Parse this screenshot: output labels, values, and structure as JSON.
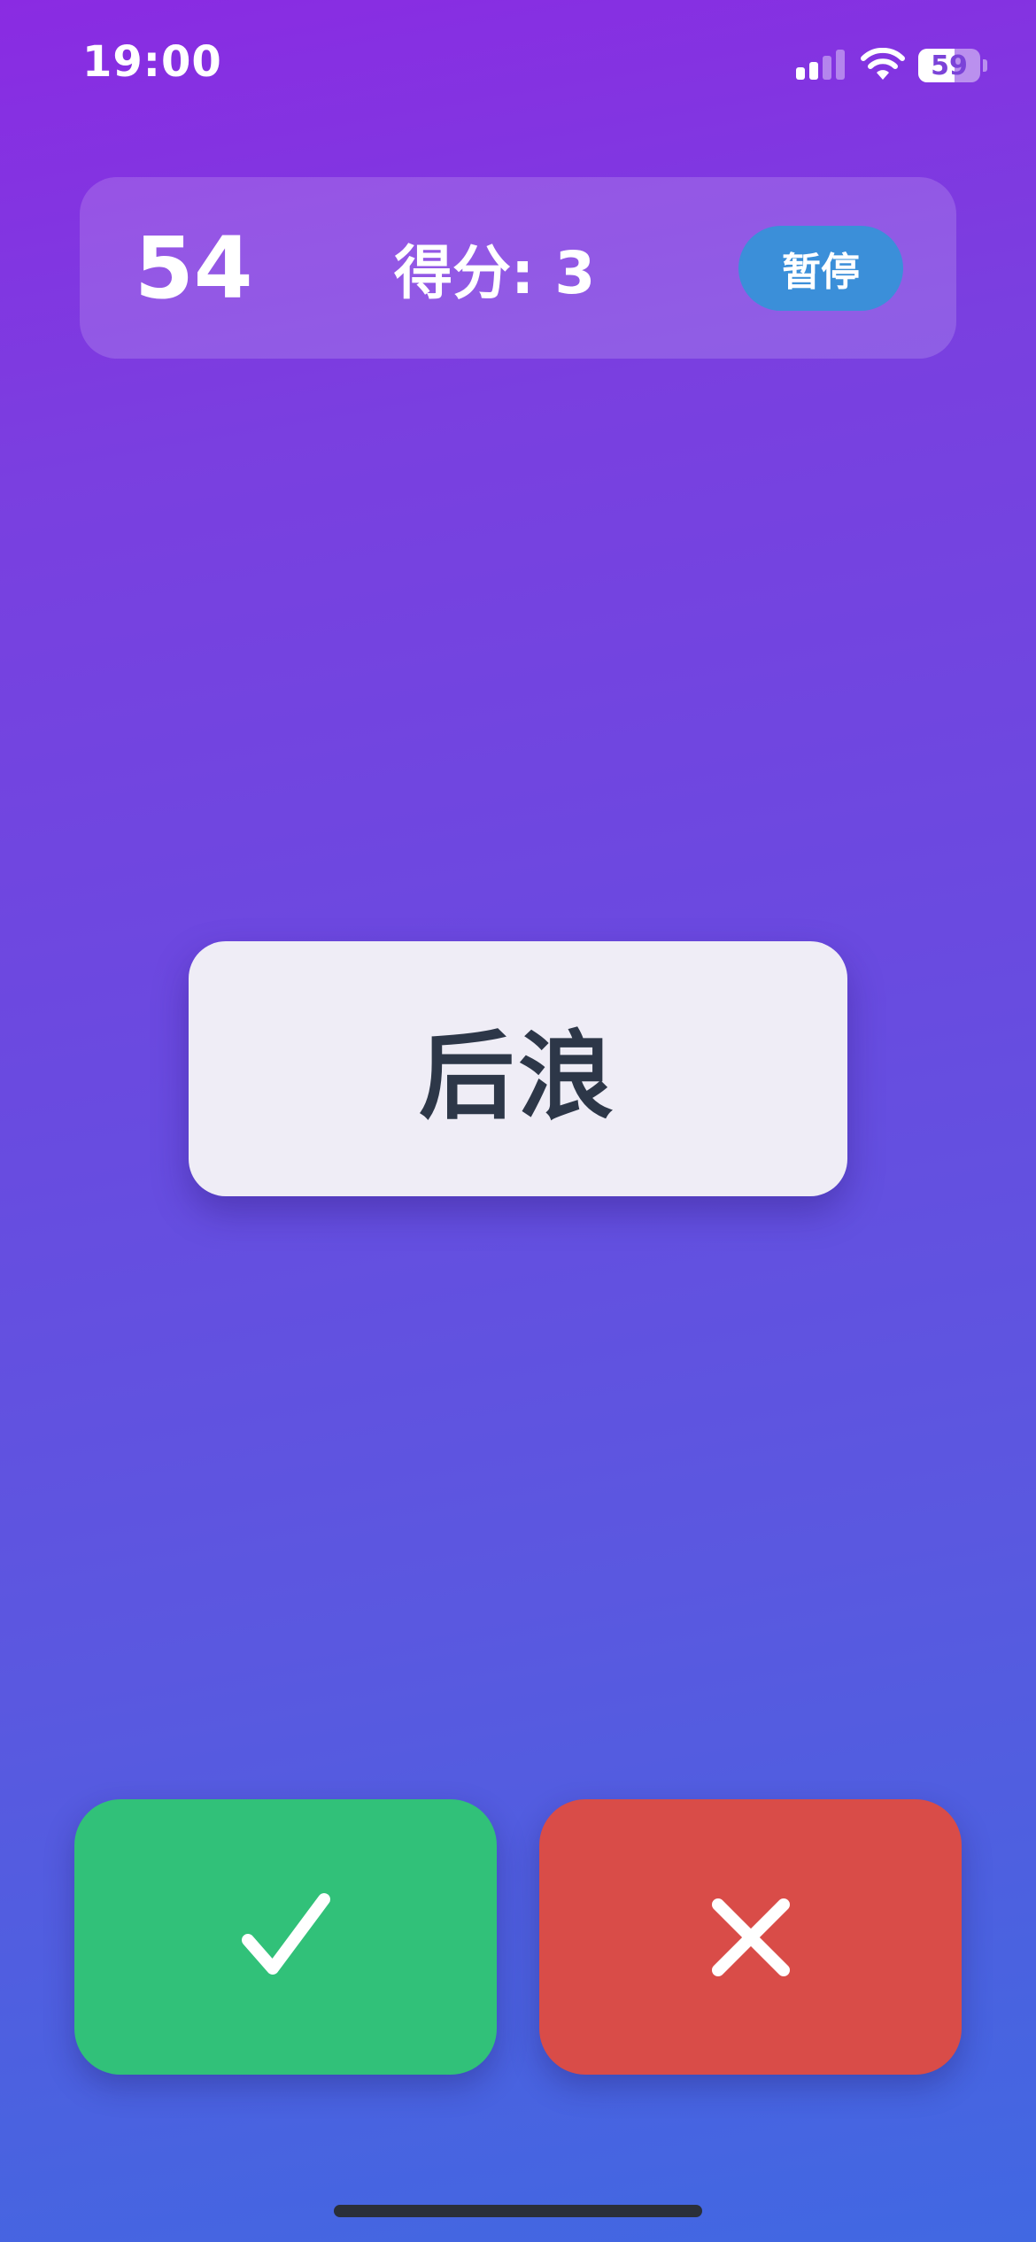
{
  "status_bar": {
    "time": "19:00",
    "battery_level": "59",
    "icons": [
      "signal-icon",
      "wifi-icon",
      "battery-icon"
    ]
  },
  "game": {
    "timer": "54",
    "score_text": "得分: 3",
    "pause_label": "暂停",
    "word": "后浪"
  },
  "actions": {
    "correct_icon": "checkmark-icon",
    "wrong_icon": "close-icon"
  },
  "colors": {
    "correct": "#31c179",
    "wrong": "#d94c48",
    "pause": "#3b8fd9",
    "card_text": "#2d3748"
  }
}
